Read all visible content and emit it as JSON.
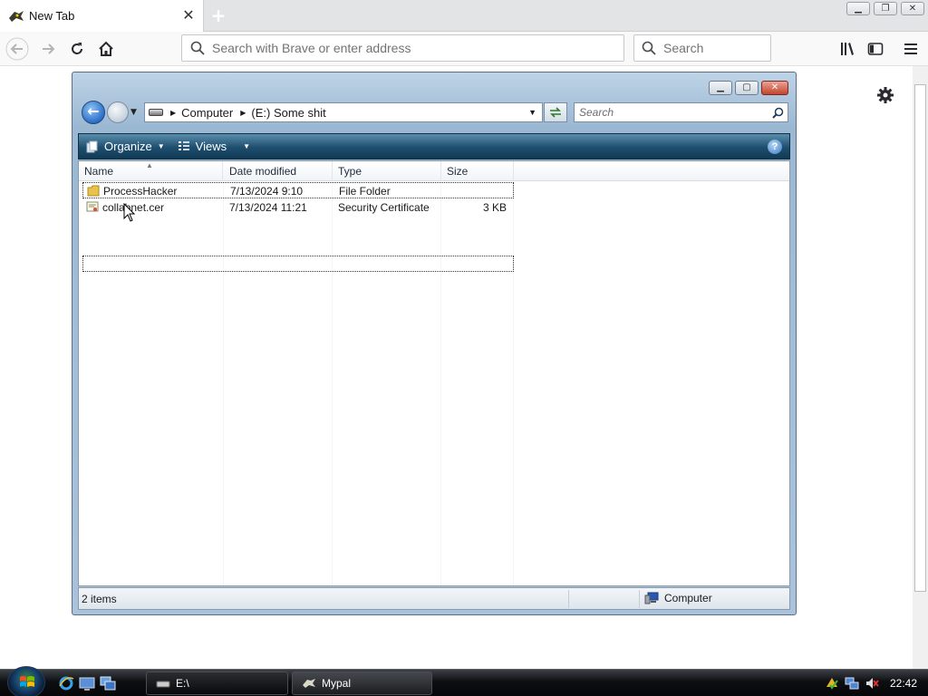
{
  "browser": {
    "tab_title": "New Tab",
    "tab_close_glyph": "✕",
    "new_tab_glyph": "+",
    "url_placeholder": "Search with Brave or enter address",
    "search_placeholder": "Search",
    "window_controls": [
      "minimize-icon",
      "restore-icon",
      "close-icon"
    ]
  },
  "explorer": {
    "breadcrumb": [
      "Computer",
      "(E:) Some shit"
    ],
    "search_placeholder": "Search",
    "toolbar": {
      "organize_label": "Organize",
      "views_label": "Views",
      "help_glyph": "?"
    },
    "columns": [
      "Name",
      "Date modified",
      "Type",
      "Size"
    ],
    "files": [
      {
        "name": "ProcessHacker",
        "date": "7/13/2024 9:10",
        "type": "File Folder",
        "size": "",
        "icon": "folder-icon",
        "selected": true
      },
      {
        "name": "collabnet.cer",
        "date": "7/13/2024 11:21",
        "type": "Security Certificate",
        "size": "3 KB",
        "icon": "certificate-icon",
        "selected": false
      }
    ],
    "status": {
      "item_count": "2 items",
      "location": "Computer"
    }
  },
  "taskbar": {
    "buttons": [
      {
        "label": "E:\\",
        "icon": "drive-icon"
      },
      {
        "label": "Mypal",
        "icon": "mypal-icon"
      }
    ],
    "clock": "22:42"
  },
  "colors": {
    "accent": "#1e4e6f",
    "taskbar": "#0d0f12",
    "close_red": "#c3452e"
  }
}
